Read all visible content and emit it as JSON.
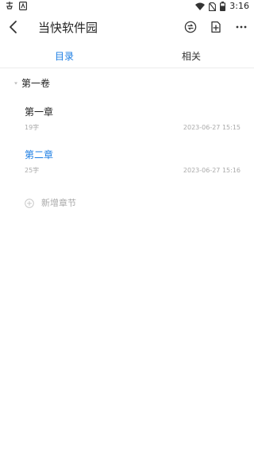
{
  "status_bar": {
    "time": "3:16",
    "icons": [
      "app-icon-1",
      "app-icon-2",
      "wifi-icon",
      "no-sim-icon",
      "battery-icon"
    ]
  },
  "app_bar": {
    "title": "当快软件园",
    "icons": [
      "back-icon",
      "sync-icon",
      "add-file-icon",
      "more-icon"
    ]
  },
  "tabs": [
    {
      "label": "目录",
      "active": true
    },
    {
      "label": "相关",
      "active": false
    }
  ],
  "volume": {
    "title": "第一卷"
  },
  "chapters": [
    {
      "title": "第一章",
      "word_count": "19字",
      "date": "2023-06-27 15:15",
      "active": false
    },
    {
      "title": "第二章",
      "word_count": "25字",
      "date": "2023-06-27 15:16",
      "active": true
    }
  ],
  "add_chapter": {
    "label": "新增章节",
    "icon": "plus-circle-icon"
  },
  "colors": {
    "accent": "#1b7de3",
    "muted": "#aaaaaa",
    "text": "#222222"
  }
}
